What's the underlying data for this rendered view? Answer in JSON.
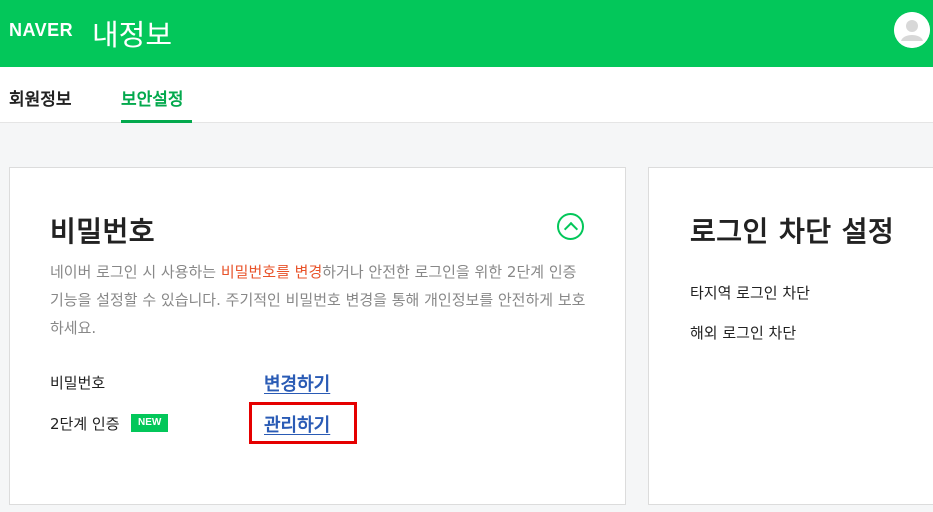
{
  "header": {
    "logo": "NAVER",
    "service": "내정보",
    "avatar_icon": "user-avatar-icon"
  },
  "tabs": [
    {
      "label": "회원정보",
      "active": false
    },
    {
      "label": "보안설정",
      "active": true
    }
  ],
  "password_card": {
    "title": "비밀번호",
    "toggle_icon": "chevron-up-circle-icon",
    "desc_before": "네이버 로그인 시 사용하는 ",
    "desc_highlight": "비밀번호를 변경",
    "desc_after": "하거나 안전한 로그인을 위한 2단계 인증 기능을 설정할 수 있습니다. 주기적인 비밀번호 변경을 통해 개인정보를 안전하게 보호하세요.",
    "rows": [
      {
        "label": "비밀번호",
        "link": "변경하기"
      },
      {
        "label": "2단계 인증",
        "badge": "NEW",
        "link": "관리하기"
      }
    ]
  },
  "login_card": {
    "title": "로그인 차단 설정",
    "items": [
      "타지역 로그인 차단",
      "해외 로그인 차단"
    ]
  },
  "colors": {
    "brand": "#03c75a",
    "link": "#2a5bb5",
    "highlight": "#e8532a",
    "annotation_box": "#e50000"
  }
}
